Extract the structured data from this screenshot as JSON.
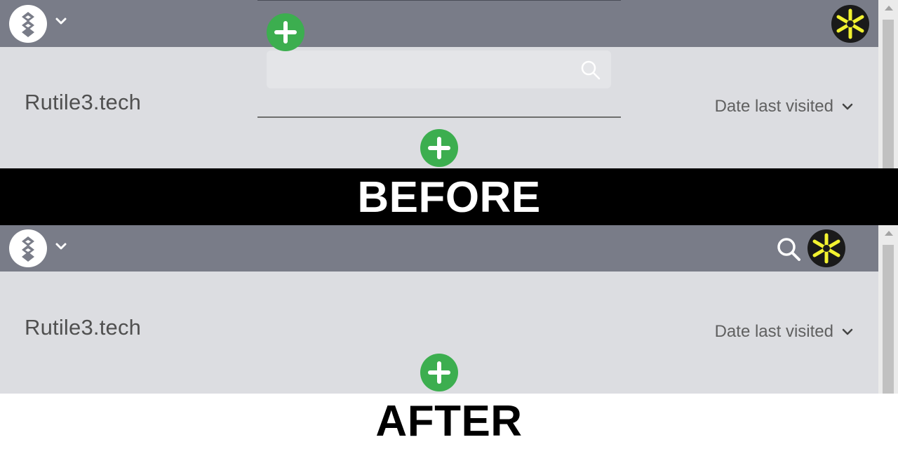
{
  "labels": {
    "before": "BEFORE",
    "after": "AFTER"
  },
  "site": {
    "title": "Rutile3.tech"
  },
  "sort": {
    "label": "Date last visited"
  },
  "search": {
    "placeholder": ""
  },
  "icons": {
    "logo": "app-logo-icon",
    "menu": "chevron-down-icon",
    "avatar": "user-avatar",
    "add": "plus-circle-icon",
    "search": "search-icon"
  },
  "colors": {
    "topbar": "#797c88",
    "content_bg": "#dcdde1",
    "add_button": "#3cae4f",
    "label_bar": "#000000",
    "avatar_star": "#f2f230"
  }
}
